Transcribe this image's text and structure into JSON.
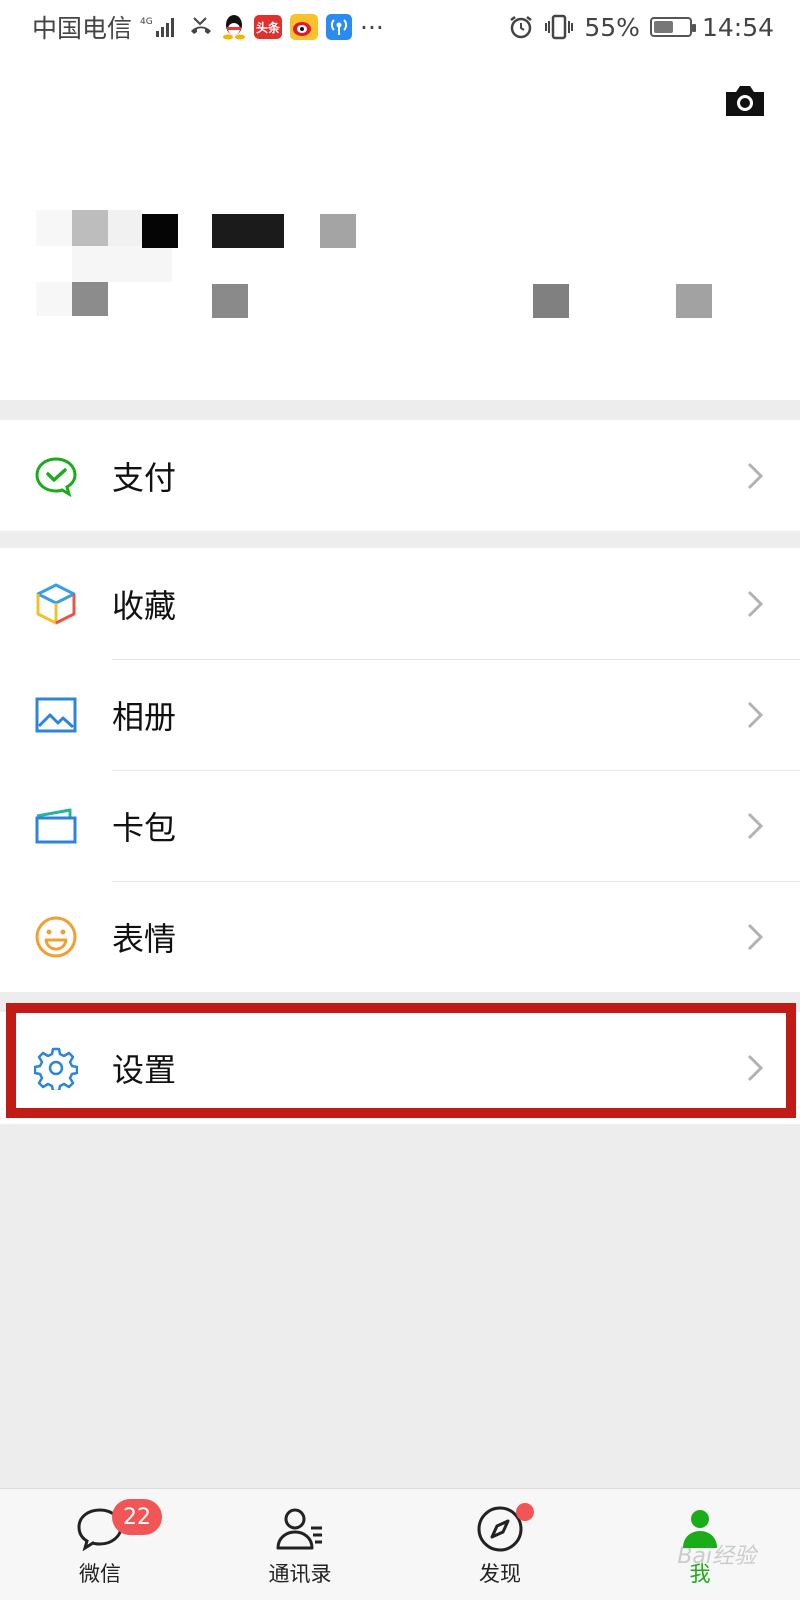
{
  "status_bar": {
    "carrier": "中国电信",
    "network": "4G",
    "toutiao_badge": "头条",
    "more": "···",
    "battery": "55%",
    "battery_level": 0.55,
    "time": "14:54"
  },
  "menu": {
    "pay": "支付",
    "favorites": "收藏",
    "album": "相册",
    "cards": "卡包",
    "stickers": "表情",
    "settings": "设置"
  },
  "tabbar": {
    "chats": "微信",
    "chats_badge": "22",
    "contacts": "通讯录",
    "discover": "发现",
    "me": "我",
    "watermark": "Bai经验"
  },
  "colors": {
    "accent_green": "#1aad19",
    "badge_red": "#f25555",
    "highlight_red": "#c01b14"
  }
}
